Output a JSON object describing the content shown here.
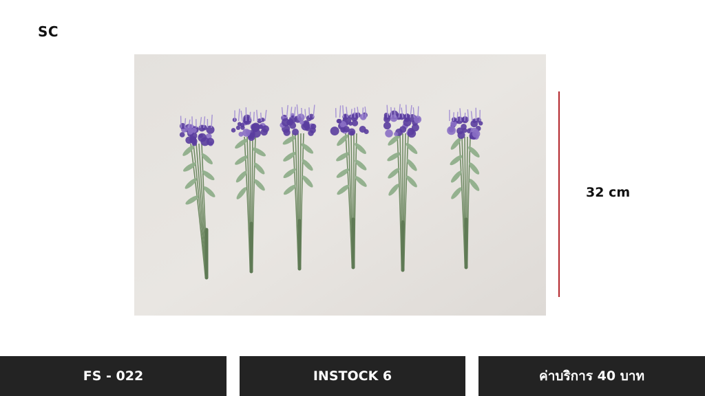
{
  "brand": "SC",
  "product_photo": {
    "subject": "six purple lavender flower stems",
    "colors": {
      "background": "#e9e6e2",
      "petals": "#5a3d9e",
      "leaves": "#8fae8a",
      "stems": "#6f8a63"
    }
  },
  "dimension": {
    "label": "32 cm",
    "bar_color": "#b3262b"
  },
  "footer": {
    "product_code": "FS - 022",
    "stock": "INSTOCK 6",
    "service_fee": "ค่าบริการ 40 บาท",
    "bar_color": "#232323"
  }
}
